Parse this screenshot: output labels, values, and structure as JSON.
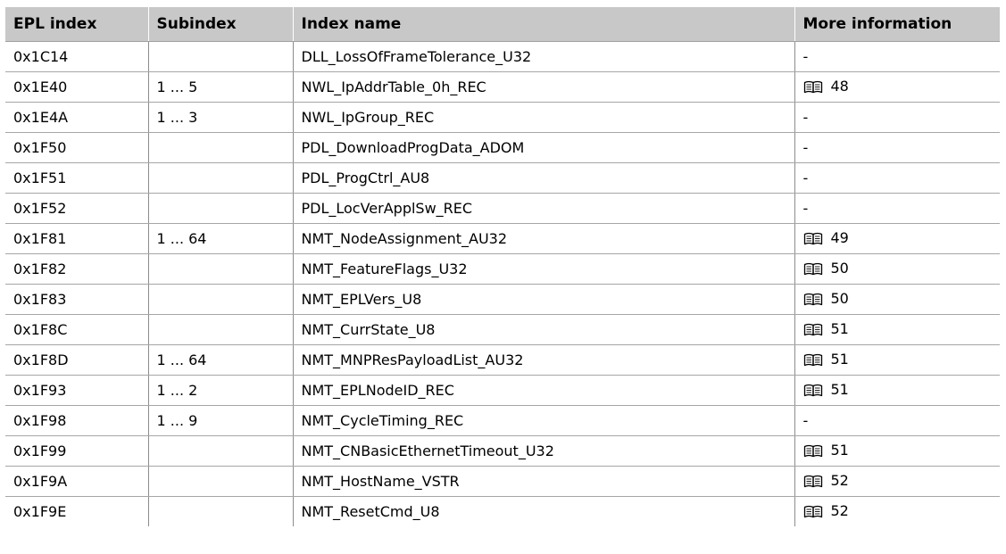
{
  "table": {
    "headers": [
      "EPL index",
      "Subindex",
      "Index name",
      "More information"
    ],
    "rows": [
      {
        "index": "0x1C14",
        "subindex": "",
        "name": "DLL_LossOfFrameTolerance_U32",
        "info": "-",
        "ref": false
      },
      {
        "index": "0x1E40",
        "subindex": "1 ... 5",
        "name": "NWL_IpAddrTable_0h_REC",
        "info": "48",
        "ref": true
      },
      {
        "index": "0x1E4A",
        "subindex": "1 ... 3",
        "name": "NWL_IpGroup_REC",
        "info": "-",
        "ref": false
      },
      {
        "index": "0x1F50",
        "subindex": "",
        "name": "PDL_DownloadProgData_ADOM",
        "info": "-",
        "ref": false
      },
      {
        "index": "0x1F51",
        "subindex": "",
        "name": "PDL_ProgCtrl_AU8",
        "info": "-",
        "ref": false
      },
      {
        "index": "0x1F52",
        "subindex": "",
        "name": "PDL_LocVerApplSw_REC",
        "info": "-",
        "ref": false
      },
      {
        "index": "0x1F81",
        "subindex": "1 ... 64",
        "name": "NMT_NodeAssignment_AU32",
        "info": "49",
        "ref": true
      },
      {
        "index": "0x1F82",
        "subindex": "",
        "name": "NMT_FeatureFlags_U32",
        "info": "50",
        "ref": true
      },
      {
        "index": "0x1F83",
        "subindex": "",
        "name": "NMT_EPLVers_U8",
        "info": "50",
        "ref": true
      },
      {
        "index": "0x1F8C",
        "subindex": "",
        "name": "NMT_CurrState_U8",
        "info": "51",
        "ref": true
      },
      {
        "index": "0x1F8D",
        "subindex": "1 ... 64",
        "name": "NMT_MNPResPayloadList_AU32",
        "info": "51",
        "ref": true
      },
      {
        "index": "0x1F93",
        "subindex": "1 ... 2",
        "name": "NMT_EPLNodeID_REC",
        "info": "51",
        "ref": true
      },
      {
        "index": "0x1F98",
        "subindex": "1 ... 9",
        "name": "NMT_CycleTiming_REC",
        "info": "-",
        "ref": false
      },
      {
        "index": "0x1F99",
        "subindex": "",
        "name": "NMT_CNBasicEthernetTimeout_U32",
        "info": "51",
        "ref": true
      },
      {
        "index": "0x1F9A",
        "subindex": "",
        "name": "NMT_HostName_VSTR",
        "info": "52",
        "ref": true
      },
      {
        "index": "0x1F9E",
        "subindex": "",
        "name": "NMT_ResetCmd_U8",
        "info": "52",
        "ref": true
      }
    ]
  },
  "icons": {
    "reference": "book-icon"
  },
  "colors": {
    "header_background": "#c8c8c8",
    "row_divider": "#a6a6a6",
    "column_divider": "#8c8c8c"
  }
}
